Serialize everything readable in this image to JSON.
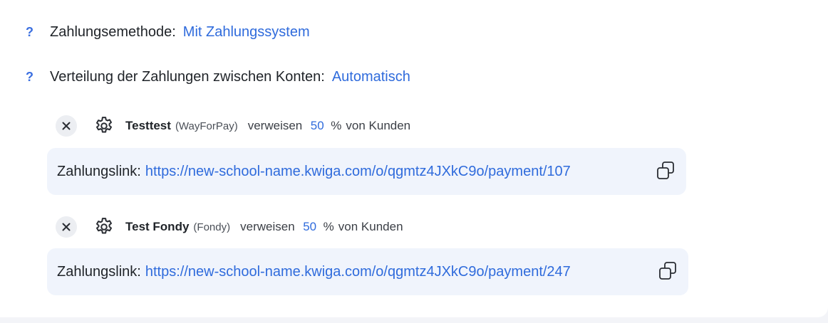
{
  "settings": {
    "payment_method": {
      "help": "?",
      "label": "Zahlungsemethode:",
      "value": "Mit Zahlungssystem"
    },
    "distribution": {
      "help": "?",
      "label": "Verteilung der Zahlungen zwischen Konten:",
      "value": "Automatisch"
    }
  },
  "accounts": [
    {
      "name": "Testtest",
      "provider": "(WayForPay)",
      "refer_label": "verweisen",
      "percent": "50",
      "percent_sign": "%",
      "suffix": "von Kunden",
      "link_label": "Zahlungslink:",
      "link_url": "https://new-school-name.kwiga.com/o/qgmtz4JXkC9o/payment/107"
    },
    {
      "name": "Test Fondy",
      "provider": "(Fondy)",
      "refer_label": "verweisen",
      "percent": "50",
      "percent_sign": "%",
      "suffix": "von Kunden",
      "link_label": "Zahlungslink:",
      "link_url": "https://new-school-name.kwiga.com/o/qgmtz4JXkC9o/payment/247"
    }
  ],
  "icons": {
    "remove": "close-icon",
    "settings": "gear-icon",
    "copy": "copy-icon"
  },
  "colors": {
    "link": "#2f6bdc",
    "help": "#3b6fe0",
    "link_box_bg": "#f0f4fc",
    "remove_bg": "#eceef2"
  }
}
